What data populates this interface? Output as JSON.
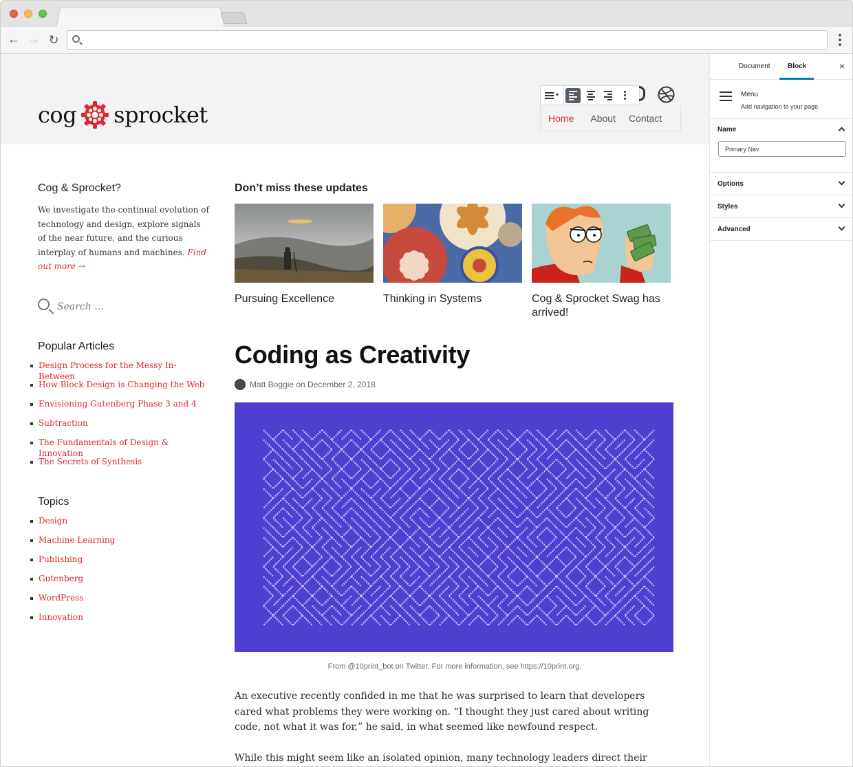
{
  "browser": {
    "url": "",
    "colors": {
      "close": "#ee5f57",
      "minimize": "#f6be4f",
      "zoom": "#5fc454"
    }
  },
  "site": {
    "logo_left": "cog",
    "logo_right": "sprocket",
    "accent_color": "#e0282f",
    "nav": [
      "Home",
      "About",
      "Contact"
    ]
  },
  "sidebar": {
    "intro_title": "Cog & Sprocket?",
    "intro_text": "We investigate the continual evolution of technology and design, explore signals of the near future, and the curious interplay of humans and machines.",
    "intro_link": "Find out more →",
    "search_placeholder": "Search …",
    "popular_title": "Popular Articles",
    "popular": [
      "Design Process for the Messy In-Between",
      "How Block Design is Changing the Web",
      "Envisioning Gutenberg Phase 3 and 4",
      "Subtraction",
      "The Fundamentals of Design & Innovation",
      "The Secrets of Synthesis"
    ],
    "topics_title": "Topics",
    "topics": [
      "Design",
      "Machine Learning",
      "Publishing",
      "Gutenberg",
      "WordPress",
      "Innovation"
    ]
  },
  "main": {
    "updates_title": "Don’t miss these updates",
    "cards": [
      {
        "title": "Pursuing Excellence"
      },
      {
        "title": "Thinking in Systems"
      },
      {
        "title": "Cog & Sprocket Swag has arrived!"
      }
    ],
    "post_title": "Coding as Creativity",
    "byline": "Matt Boggie on December 2, 2018",
    "hero_color": "#4f3fd1",
    "caption": "From @10print_bot on Twitter. For more information, see https://10print.org.",
    "para1": "An executive recently confided in me that he was surprised to learn that developers cared what problems they were working on. “I thought they just cared about writing code, not what it was for,” he said, in what seemed like newfound respect.",
    "para2": "While this might seem like an isolated opinion, many technology leaders direct their developers"
  },
  "settings": {
    "tab_document": "Document",
    "tab_block": "Block",
    "close_icon": "×",
    "block_name": "Menu",
    "block_desc": "Add navigation to your page.",
    "name_label": "Name",
    "name_value": "Primary Nav",
    "panels": [
      "Options",
      "Styles",
      "Advanced"
    ],
    "active_tab_color": "#007cba"
  }
}
